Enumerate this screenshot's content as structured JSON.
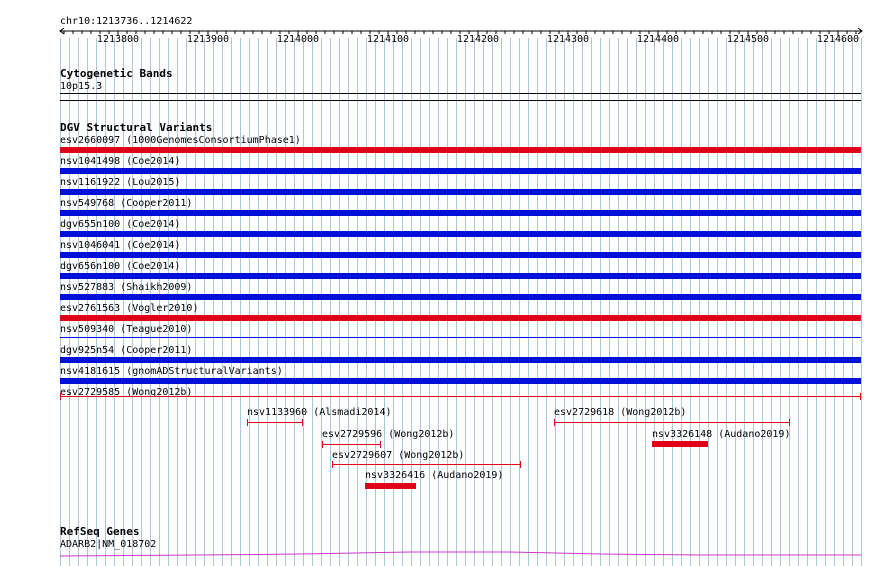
{
  "locus": "chr10:1213736..1214622",
  "colors": {
    "grid": "#a8c8e0",
    "loss": "#e0001a",
    "gain": "#0010d8",
    "gene": "#cc33cc"
  },
  "ruler": {
    "ticks": [
      "1213800",
      "1213900",
      "1214000",
      "1214100",
      "1214200",
      "1214300",
      "1214400",
      "1214500",
      "1214600"
    ]
  },
  "cytobands": {
    "title": "Cytogenetic Bands",
    "band": "10p15.3"
  },
  "dgv": {
    "title": "DGV Structural Variants",
    "variants": [
      {
        "label": "esv2660097 (1000GenomesConsortiumPhase1)",
        "type": "loss"
      },
      {
        "label": "nsv1041498 (Coe2014)",
        "type": "gain"
      },
      {
        "label": "nsv1161922 (Lou2015)",
        "type": "gain"
      },
      {
        "label": "nsv549768 (Cooper2011)",
        "type": "gain"
      },
      {
        "label": "dgv655n100 (Coe2014)",
        "type": "gain"
      },
      {
        "label": "nsv1046041 (Coe2014)",
        "type": "gain"
      },
      {
        "label": "dgv656n100 (Coe2014)",
        "type": "gain"
      },
      {
        "label": "nsv527883 (Shaikh2009)",
        "type": "gain"
      },
      {
        "label": "esv2761563 (Vogler2010)",
        "type": "loss"
      },
      {
        "label": "nsv509340 (Teague2010)",
        "type": "gain-thin"
      },
      {
        "label": "dgv925n54 (Cooper2011)",
        "type": "gain"
      },
      {
        "label": "nsv4181615 (gnomADStructuralVariants)",
        "type": "gain"
      },
      {
        "label": "esv2729585 (Wong2012b)",
        "type": "loss-thin"
      }
    ],
    "small_variants": [
      {
        "label": "nsv1133960 (Alsmadi2014)",
        "style": "range"
      },
      {
        "label": "esv2729618 (Wong2012b)",
        "style": "range"
      },
      {
        "label": "esv2729596 (Wong2012b)",
        "style": "range"
      },
      {
        "label": "nsv3326148 (Audano2019)",
        "style": "block"
      },
      {
        "label": "esv2729607 (Wong2012b)",
        "style": "range"
      },
      {
        "label": "nsv3326416 (Audano2019)",
        "style": "block"
      }
    ]
  },
  "refseq": {
    "title": "RefSeq Genes",
    "gene": "ADARB2|NM_018702"
  }
}
